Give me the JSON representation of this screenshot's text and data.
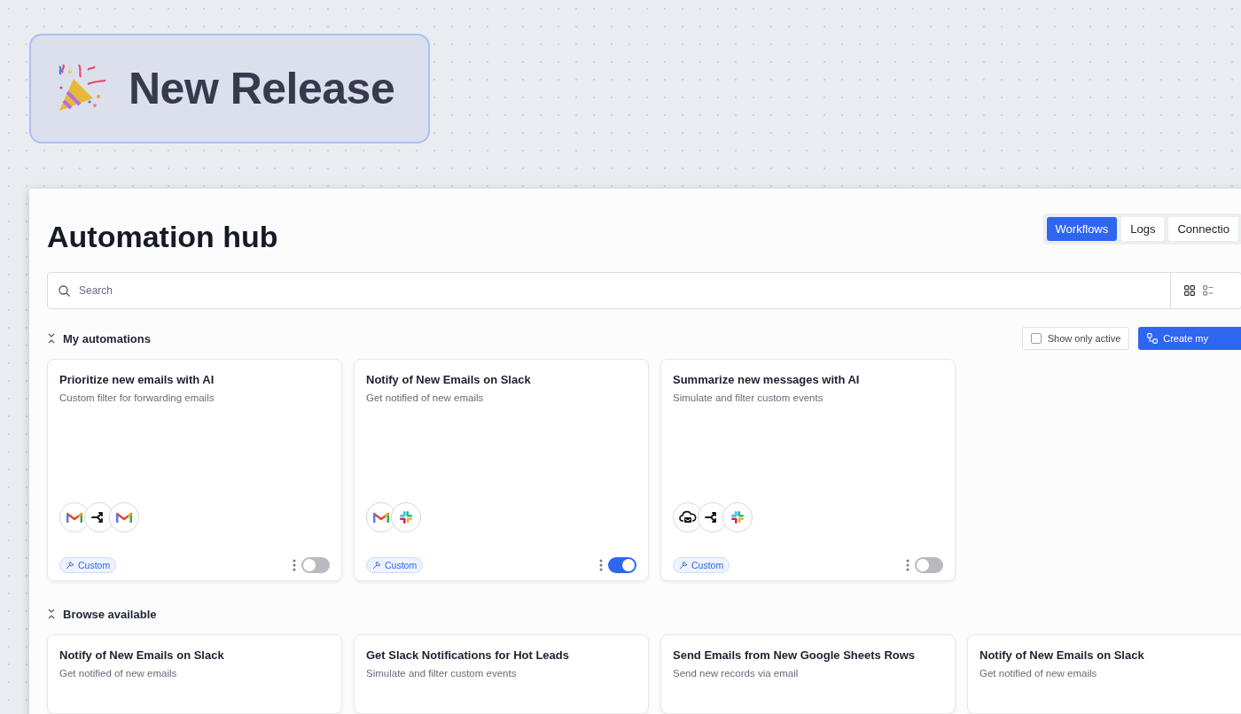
{
  "banner": {
    "title": "New Release"
  },
  "page": {
    "title": "Automation hub"
  },
  "tabs": [
    {
      "label": "Workflows",
      "selected": true
    },
    {
      "label": "Logs",
      "selected": false
    },
    {
      "label": "Connectio",
      "selected": false
    }
  ],
  "search": {
    "placeholder": "Search"
  },
  "my_automations": {
    "title": "My automations",
    "filter": {
      "label": "Show only active",
      "checked": false
    },
    "create_button": "Create my",
    "cards": [
      {
        "title": "Prioritize new emails with AI",
        "description": "Custom filter for forwarding emails",
        "apps": [
          {
            "kind": "mail"
          },
          {
            "kind": "split"
          },
          {
            "kind": "mail"
          }
        ],
        "tag": "Custom",
        "on": false
      },
      {
        "title": "Notify of New Emails on Slack",
        "description": "Get notified of new emails",
        "apps": [
          {
            "kind": "mail"
          },
          {
            "kind": "chat"
          }
        ],
        "tag": "Custom",
        "on": true
      },
      {
        "title": "Summarize new messages with AI",
        "description": "Simulate and filter custom events",
        "apps": [
          {
            "kind": "cloud"
          },
          {
            "kind": "split"
          },
          {
            "kind": "chat"
          }
        ],
        "tag": "Custom",
        "on": false
      }
    ]
  },
  "browse_available": {
    "title": "Browse available",
    "cards": [
      {
        "title": "Notify of New Emails on Slack",
        "description": "Get notified of new emails"
      },
      {
        "title": "Get Slack Notifications for Hot Leads",
        "description": "Simulate and filter custom events"
      },
      {
        "title": "Send Emails from New Google Sheets Rows",
        "description": "Send new records via email"
      },
      {
        "title": "Notify of New Emails on Slack",
        "description": "Get notified of new emails"
      }
    ]
  }
}
